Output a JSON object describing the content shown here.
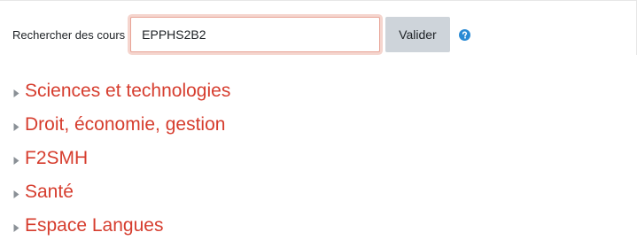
{
  "search": {
    "label": "Rechercher des cours",
    "value": "EPPHS2B2",
    "submit_label": "Valider",
    "help_icon": "question-circle-icon"
  },
  "categories": [
    {
      "label": "Sciences et technologies",
      "icon": "caret-right-icon"
    },
    {
      "label": "Droit, économie, gestion",
      "icon": "caret-right-icon"
    },
    {
      "label": "F2SMH",
      "icon": "caret-right-icon"
    },
    {
      "label": "Santé",
      "icon": "caret-right-icon"
    },
    {
      "label": "Espace Langues",
      "icon": "caret-right-icon"
    }
  ],
  "colors": {
    "link": "#d63d2e",
    "help_icon": "#2a8ad4",
    "button_bg": "#ced4da",
    "focus_ring": "#e8a497"
  }
}
